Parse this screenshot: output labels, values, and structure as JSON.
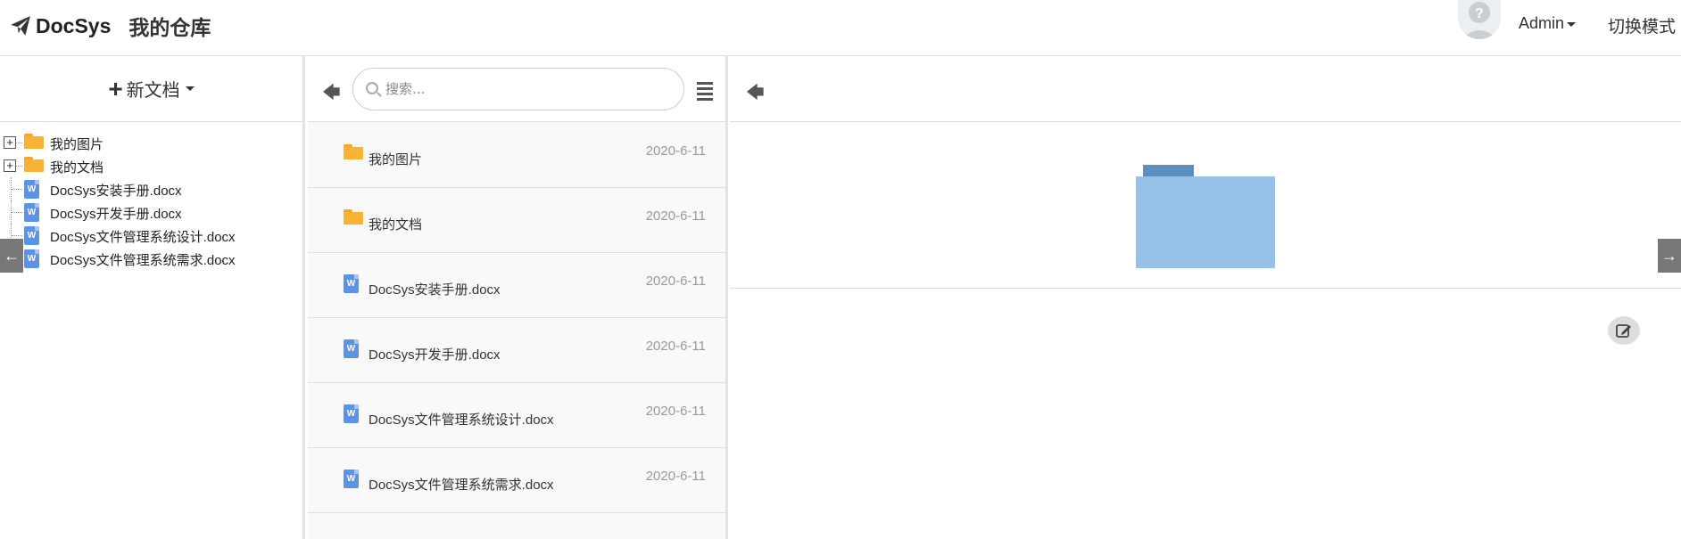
{
  "header": {
    "brand": "DocSys",
    "repo_title": "我的仓库",
    "user_label": "Admin",
    "switch_mode": "切换模式"
  },
  "left": {
    "new_doc_label": "新文档",
    "tree": [
      {
        "label": "我的图片",
        "type": "folder"
      },
      {
        "label": "我的文档",
        "type": "folder"
      },
      {
        "label": "DocSys安装手册.docx",
        "type": "word"
      },
      {
        "label": "DocSys开发手册.docx",
        "type": "word"
      },
      {
        "label": "DocSys文件管理系统设计.docx",
        "type": "word"
      },
      {
        "label": "DocSys文件管理系统需求.docx",
        "type": "word"
      }
    ]
  },
  "middle": {
    "search_placeholder": "搜索...",
    "files": [
      {
        "name": "我的图片",
        "date": "2020-6-11",
        "type": "folder"
      },
      {
        "name": "我的文档",
        "date": "2020-6-11",
        "type": "folder"
      },
      {
        "name": "DocSys安装手册.docx",
        "date": "2020-6-11",
        "type": "word"
      },
      {
        "name": "DocSys开发手册.docx",
        "date": "2020-6-11",
        "type": "word"
      },
      {
        "name": "DocSys文件管理系统设计.docx",
        "date": "2020-6-11",
        "type": "word"
      },
      {
        "name": "DocSys文件管理系统需求.docx",
        "date": "2020-6-11",
        "type": "word"
      }
    ]
  },
  "icons": {
    "word_letter": "W",
    "folder_color": "#f9b233",
    "word_color": "#5b94e6",
    "preview_folder_color": "#97c1e6"
  }
}
